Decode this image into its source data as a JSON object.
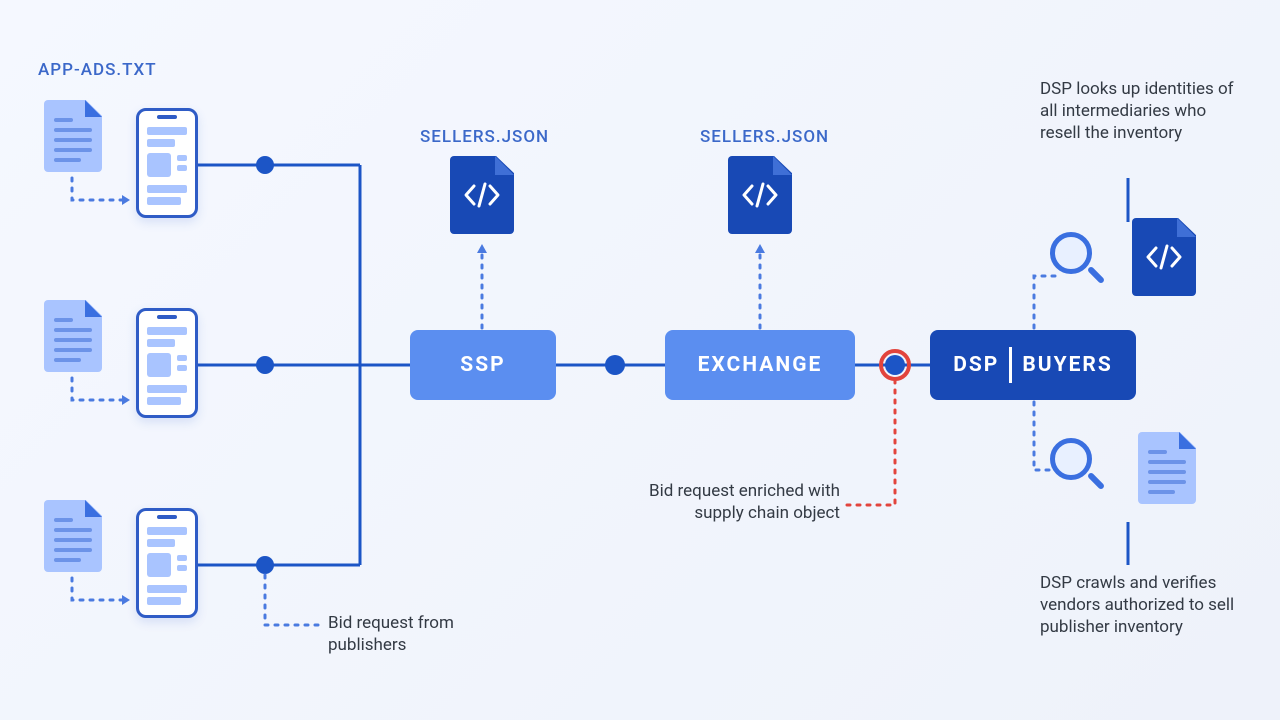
{
  "labels": {
    "app_ads": "APP-ADS.TXT",
    "sellers_json_1": "SELLERS.JSON",
    "sellers_json_2": "SELLERS.JSON"
  },
  "nodes": {
    "ssp": "SSP",
    "exchange": "EXCHANGE",
    "dsp_left": "DSP",
    "dsp_right": "BUYERS"
  },
  "descriptions": {
    "bid_request_publishers": "Bid request from publishers",
    "bid_request_enriched": "Bid request enriched with supply chain object",
    "dsp_lookup": "DSP looks up identities of all intermediaries who resell the inventory",
    "dsp_crawl": "DSP crawls and verifies vendors authorized to sell publisher inventory"
  },
  "colors": {
    "line_blue": "#1c55c6",
    "dotted_blue": "#4a7ae0",
    "dotted_red": "#e2443d",
    "node_light": "#5b8ef0",
    "node_dark": "#1849b5"
  }
}
